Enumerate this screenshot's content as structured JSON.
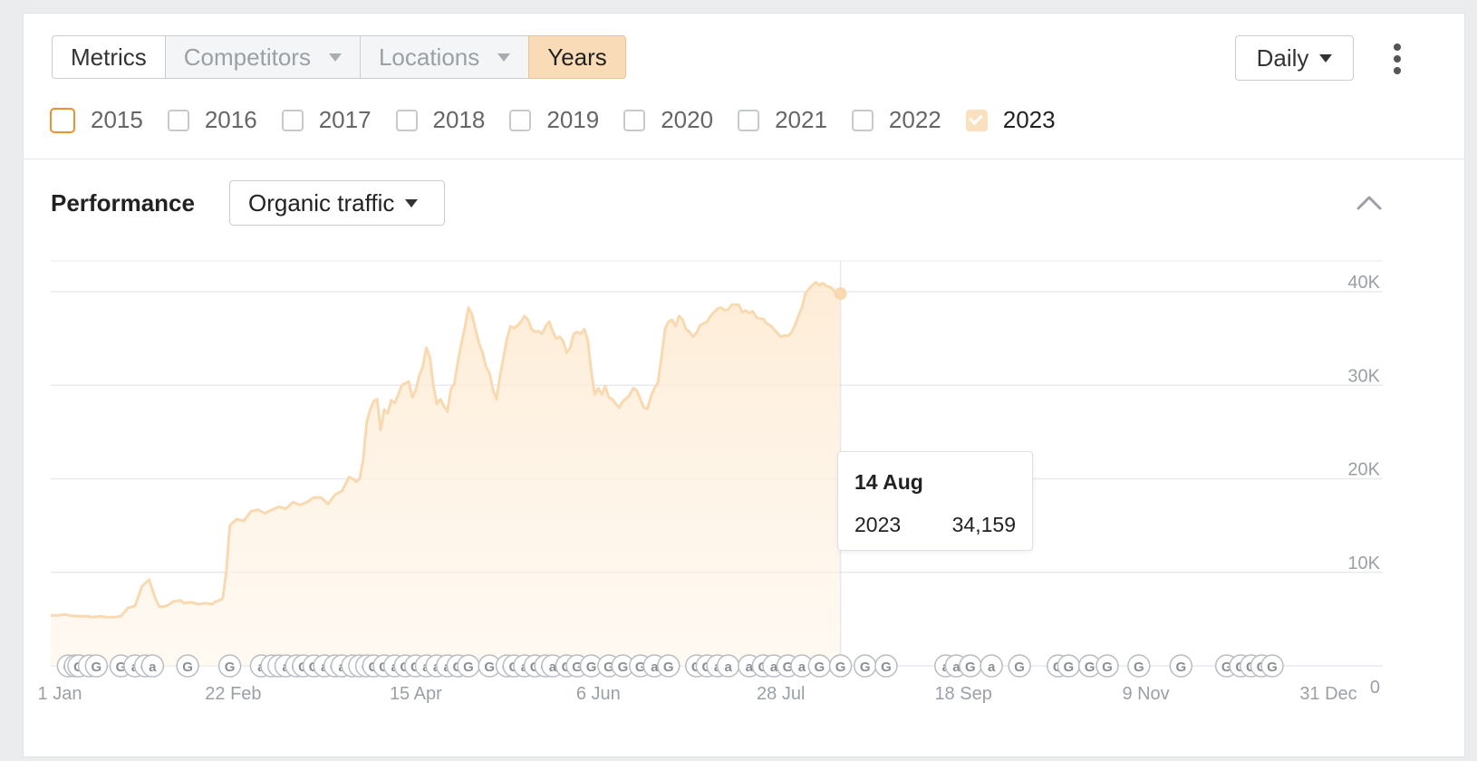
{
  "toolbar": {
    "tabs": [
      {
        "label": "Metrics",
        "dropdown": false,
        "state": "normal"
      },
      {
        "label": "Competitors",
        "dropdown": true,
        "state": "disabled"
      },
      {
        "label": "Locations",
        "dropdown": true,
        "state": "disabled"
      },
      {
        "label": "Years",
        "dropdown": false,
        "state": "active"
      }
    ],
    "interval_label": "Daily"
  },
  "years": [
    {
      "label": "2015",
      "checked": false
    },
    {
      "label": "2016",
      "checked": false
    },
    {
      "label": "2017",
      "checked": false
    },
    {
      "label": "2018",
      "checked": false
    },
    {
      "label": "2019",
      "checked": false
    },
    {
      "label": "2020",
      "checked": false
    },
    {
      "label": "2021",
      "checked": false
    },
    {
      "label": "2022",
      "checked": false
    },
    {
      "label": "2023",
      "checked": true
    }
  ],
  "performance": {
    "title": "Performance",
    "metric_label": "Organic traffic"
  },
  "tooltip": {
    "date": "14 Aug",
    "series": "2023",
    "value": "34,159"
  },
  "colors": {
    "accent": "#f9dcb7",
    "line": "#f8d9b1",
    "focus": "#f0902e"
  },
  "chart_data": {
    "type": "area",
    "series": [
      {
        "name": "2023"
      }
    ],
    "x_tick_labels": [
      "1 Jan",
      "22 Feb",
      "15 Apr",
      "6 Jun",
      "28 Jul",
      "18 Sep",
      "9 Nov",
      "31 Dec"
    ],
    "x_tick_days": [
      0,
      52,
      104,
      156,
      208,
      260,
      312,
      364
    ],
    "y_tick_labels": [
      "40K",
      "30K",
      "20K",
      "10K",
      "0"
    ],
    "y_tick_values": [
      40000,
      30000,
      20000,
      10000,
      0
    ],
    "ylim": [
      0,
      40000
    ],
    "xlim_days": [
      0,
      364
    ],
    "grid": true,
    "crosshair_day": 225,
    "points": [
      [
        0,
        5400
      ],
      [
        2,
        5400
      ],
      [
        4,
        5500
      ],
      [
        6,
        5350
      ],
      [
        8,
        5300
      ],
      [
        10,
        5300
      ],
      [
        12,
        5200
      ],
      [
        14,
        5300
      ],
      [
        16,
        5200
      ],
      [
        18,
        5200
      ],
      [
        20,
        5300
      ],
      [
        22,
        6200
      ],
      [
        24,
        6400
      ],
      [
        26,
        8500
      ],
      [
        28,
        9200
      ],
      [
        30,
        7000
      ],
      [
        31,
        6300
      ],
      [
        33,
        6400
      ],
      [
        35,
        6900
      ],
      [
        37,
        7000
      ],
      [
        38,
        6700
      ],
      [
        40,
        6800
      ],
      [
        42,
        6600
      ],
      [
        44,
        6700
      ],
      [
        46,
        6600
      ],
      [
        47,
        6900
      ],
      [
        48,
        7000
      ],
      [
        49,
        7200
      ],
      [
        50,
        10000
      ],
      [
        51,
        15000
      ],
      [
        53,
        15700
      ],
      [
        55,
        15500
      ],
      [
        57,
        16500
      ],
      [
        59,
        16700
      ],
      [
        61,
        16300
      ],
      [
        63,
        16700
      ],
      [
        65,
        17000
      ],
      [
        67,
        16800
      ],
      [
        69,
        17500
      ],
      [
        71,
        17200
      ],
      [
        73,
        17500
      ],
      [
        75,
        18000
      ],
      [
        77,
        18000
      ],
      [
        79,
        17300
      ],
      [
        81,
        18300
      ],
      [
        83,
        18700
      ],
      [
        85,
        20200
      ],
      [
        86,
        20000
      ],
      [
        87,
        19700
      ],
      [
        88,
        20000
      ],
      [
        89,
        22000
      ],
      [
        90,
        26000
      ],
      [
        91,
        27400
      ],
      [
        92,
        28300
      ],
      [
        93,
        28500
      ],
      [
        94,
        25200
      ],
      [
        95,
        27400
      ],
      [
        96,
        27000
      ],
      [
        97,
        28400
      ],
      [
        98,
        28100
      ],
      [
        99,
        29000
      ],
      [
        100,
        30000
      ],
      [
        101,
        30200
      ],
      [
        102,
        30400
      ],
      [
        103,
        28700
      ],
      [
        104,
        29500
      ],
      [
        105,
        31000
      ],
      [
        106,
        32000
      ],
      [
        107,
        34000
      ],
      [
        108,
        33000
      ],
      [
        109,
        30000
      ],
      [
        110,
        28000
      ],
      [
        111,
        28500
      ],
      [
        112,
        27800
      ],
      [
        113,
        27200
      ],
      [
        114,
        29600
      ],
      [
        115,
        30200
      ],
      [
        116,
        32500
      ],
      [
        117,
        34500
      ],
      [
        118,
        36200
      ],
      [
        119,
        38300
      ],
      [
        120,
        37600
      ],
      [
        121,
        36000
      ],
      [
        122,
        34500
      ],
      [
        123,
        33500
      ],
      [
        124,
        32000
      ],
      [
        125,
        31300
      ],
      [
        126,
        29500
      ],
      [
        127,
        28500
      ],
      [
        128,
        31000
      ],
      [
        129,
        33000
      ],
      [
        130,
        35000
      ],
      [
        131,
        36300
      ],
      [
        132,
        36100
      ],
      [
        133,
        36400
      ],
      [
        134,
        36800
      ],
      [
        135,
        37400
      ],
      [
        136,
        37000
      ],
      [
        137,
        36000
      ],
      [
        138,
        35700
      ],
      [
        139,
        35800
      ],
      [
        140,
        35500
      ],
      [
        141,
        36300
      ],
      [
        142,
        36800
      ],
      [
        143,
        35800
      ],
      [
        144,
        35000
      ],
      [
        145,
        35200
      ],
      [
        146,
        34700
      ],
      [
        147,
        33500
      ],
      [
        148,
        34000
      ],
      [
        149,
        35500
      ],
      [
        150,
        35700
      ],
      [
        151,
        35500
      ],
      [
        152,
        36000
      ],
      [
        153,
        34800
      ],
      [
        154,
        31500
      ],
      [
        155,
        29000
      ],
      [
        156,
        29700
      ],
      [
        157,
        29000
      ],
      [
        158,
        29900
      ],
      [
        159,
        28700
      ],
      [
        160,
        28500
      ],
      [
        161,
        28000
      ],
      [
        162,
        27600
      ],
      [
        163,
        28300
      ],
      [
        164,
        28600
      ],
      [
        165,
        29000
      ],
      [
        166,
        29700
      ],
      [
        167,
        29400
      ],
      [
        168,
        28500
      ],
      [
        169,
        27600
      ],
      [
        170,
        27500
      ],
      [
        171,
        28800
      ],
      [
        172,
        29700
      ],
      [
        173,
        30300
      ],
      [
        174,
        33000
      ],
      [
        175,
        36000
      ],
      [
        176,
        36800
      ],
      [
        177,
        37000
      ],
      [
        178,
        36300
      ],
      [
        179,
        37400
      ],
      [
        180,
        37000
      ],
      [
        181,
        36000
      ],
      [
        182,
        35700
      ],
      [
        183,
        35200
      ],
      [
        184,
        35600
      ],
      [
        185,
        36400
      ],
      [
        186,
        36600
      ],
      [
        187,
        36800
      ],
      [
        188,
        37400
      ],
      [
        189,
        37800
      ],
      [
        190,
        38200
      ],
      [
        191,
        38300
      ],
      [
        192,
        38000
      ],
      [
        193,
        38100
      ],
      [
        194,
        38600
      ],
      [
        195,
        38600
      ],
      [
        196,
        38600
      ],
      [
        197,
        37800
      ],
      [
        198,
        38000
      ],
      [
        199,
        37700
      ],
      [
        200,
        37900
      ],
      [
        201,
        37300
      ],
      [
        202,
        37100
      ],
      [
        203,
        37100
      ],
      [
        204,
        36600
      ],
      [
        205,
        36400
      ],
      [
        206,
        36000
      ],
      [
        207,
        35600
      ],
      [
        208,
        35200
      ],
      [
        209,
        35300
      ],
      [
        210,
        35300
      ],
      [
        211,
        35600
      ],
      [
        212,
        36400
      ],
      [
        213,
        37400
      ],
      [
        214,
        38300
      ],
      [
        215,
        39800
      ],
      [
        216,
        40300
      ],
      [
        217,
        40700
      ],
      [
        218,
        41000
      ],
      [
        219,
        40700
      ],
      [
        220,
        40900
      ],
      [
        221,
        40600
      ],
      [
        222,
        40500
      ],
      [
        223,
        40200
      ],
      [
        224,
        39600
      ],
      [
        225,
        39800
      ]
    ],
    "annotations": {
      "marker_types": [
        "g",
        "a"
      ],
      "marker_days": [
        [
          5,
          "g"
        ],
        [
          7,
          "g"
        ],
        [
          8,
          "g"
        ],
        [
          11,
          "a"
        ],
        [
          13,
          "g"
        ],
        [
          20,
          "g"
        ],
        [
          24,
          "a"
        ],
        [
          27,
          "g"
        ],
        [
          29,
          "a"
        ],
        [
          39,
          "g"
        ],
        [
          51,
          "g"
        ],
        [
          60,
          "a"
        ],
        [
          63,
          "a"
        ],
        [
          65,
          "a"
        ],
        [
          67,
          "a"
        ],
        [
          70,
          "g"
        ],
        [
          72,
          "g"
        ],
        [
          75,
          "g"
        ],
        [
          78,
          "a"
        ],
        [
          81,
          "g"
        ],
        [
          83,
          "a"
        ],
        [
          86,
          "a"
        ],
        [
          88,
          "a"
        ],
        [
          90,
          "g"
        ],
        [
          92,
          "g"
        ],
        [
          95,
          "g"
        ],
        [
          98,
          "a"
        ],
        [
          101,
          "g"
        ],
        [
          104,
          "g"
        ],
        [
          107,
          "a"
        ],
        [
          110,
          "a"
        ],
        [
          113,
          "a"
        ],
        [
          116,
          "g"
        ],
        [
          119,
          "g"
        ],
        [
          125,
          "g"
        ],
        [
          130,
          "g"
        ],
        [
          132,
          "g"
        ],
        [
          135,
          "a"
        ],
        [
          138,
          "g"
        ],
        [
          141,
          "g"
        ],
        [
          143,
          "a"
        ],
        [
          147,
          "g"
        ],
        [
          150,
          "g"
        ],
        [
          154,
          "g"
        ],
        [
          159,
          "g"
        ],
        [
          163,
          "g"
        ],
        [
          168,
          "g"
        ],
        [
          172,
          "a"
        ],
        [
          176,
          "g"
        ],
        [
          184,
          "g"
        ],
        [
          187,
          "g"
        ],
        [
          190,
          "a"
        ],
        [
          193,
          "a"
        ],
        [
          199,
          "a"
        ],
        [
          203,
          "g"
        ],
        [
          206,
          "a"
        ],
        [
          210,
          "g"
        ],
        [
          214,
          "a"
        ],
        [
          219,
          "g"
        ],
        [
          225,
          "g"
        ],
        [
          232,
          "g"
        ],
        [
          238,
          "g"
        ],
        [
          255,
          "a"
        ],
        [
          258,
          "a"
        ],
        [
          262,
          "g"
        ],
        [
          268,
          "a"
        ],
        [
          276,
          "g"
        ],
        [
          287,
          "g"
        ],
        [
          290,
          "g"
        ],
        [
          296,
          "g"
        ],
        [
          301,
          "g"
        ],
        [
          310,
          "g"
        ],
        [
          322,
          "g"
        ],
        [
          335,
          "g"
        ],
        [
          339,
          "g"
        ],
        [
          342,
          "g"
        ],
        [
          345,
          "g"
        ],
        [
          348,
          "g"
        ]
      ]
    }
  }
}
